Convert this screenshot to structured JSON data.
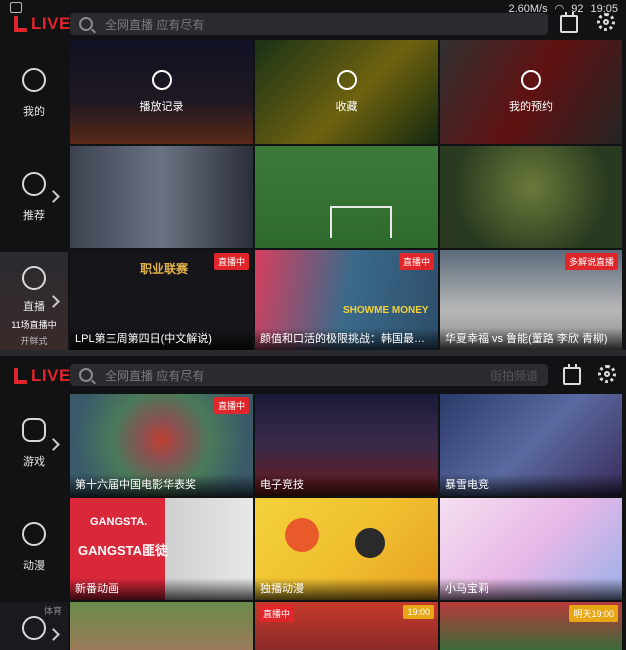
{
  "status": {
    "speed": "2.60M/s",
    "battery": "92",
    "time": "19:05"
  },
  "brand": {
    "name": "LIVE"
  },
  "search": {
    "placeholder": "全网直播 应有尽有",
    "hot": "街拍频道"
  },
  "screen1": {
    "sidebar": [
      {
        "label": "我的",
        "icon": "user-icon"
      },
      {
        "label": "推荐",
        "icon": "thumbs-up-icon"
      },
      {
        "label": "直播",
        "icon": "live-camera-icon",
        "sub": "11场直播中",
        "bottom": "开鲜式"
      }
    ],
    "quick": [
      {
        "label": "播放记录",
        "icon": "clock-icon"
      },
      {
        "label": "收藏",
        "icon": "heart-icon"
      },
      {
        "label": "我的预约",
        "icon": "alarm-icon"
      }
    ],
    "live": [
      {
        "caption": "LPL第三周第四日(中文解说)",
        "badge": "直播中",
        "art": "职业联赛"
      },
      {
        "caption": "颜值和口活的极限挑战：韩国最…",
        "badge": "直播中",
        "art": "SHOWME MONEY"
      },
      {
        "caption": "华夏幸福 vs 鲁能(董路 李欣 青柳)",
        "badge": "多解说直播"
      }
    ]
  },
  "screen2": {
    "sidebar": [
      {
        "label": "游戏",
        "icon": "gamepad-icon"
      },
      {
        "label": "动漫",
        "icon": "anime-icon"
      },
      {
        "label": "",
        "icon": "football-icon",
        "sub": "体育"
      }
    ],
    "tiles": [
      {
        "caption": "第十六届中国电影华表奖",
        "badge": "直播中"
      },
      {
        "caption": "电子竞技"
      },
      {
        "caption": "暴雪电竞"
      },
      {
        "caption": "新番动画",
        "art": "GANGSTA匪徒",
        "art2": "GANGSTA."
      },
      {
        "caption": "独播动漫"
      },
      {
        "caption": "小马宝莉"
      }
    ],
    "bottom": [
      {
        "badge": ""
      },
      {
        "badge": "19:00",
        "badge_left": "直播中"
      },
      {
        "badge": "明天19:00"
      }
    ]
  },
  "colors": {
    "accent": "#e0262a",
    "bg": "#111214",
    "badge_orange": "#e8a614"
  }
}
